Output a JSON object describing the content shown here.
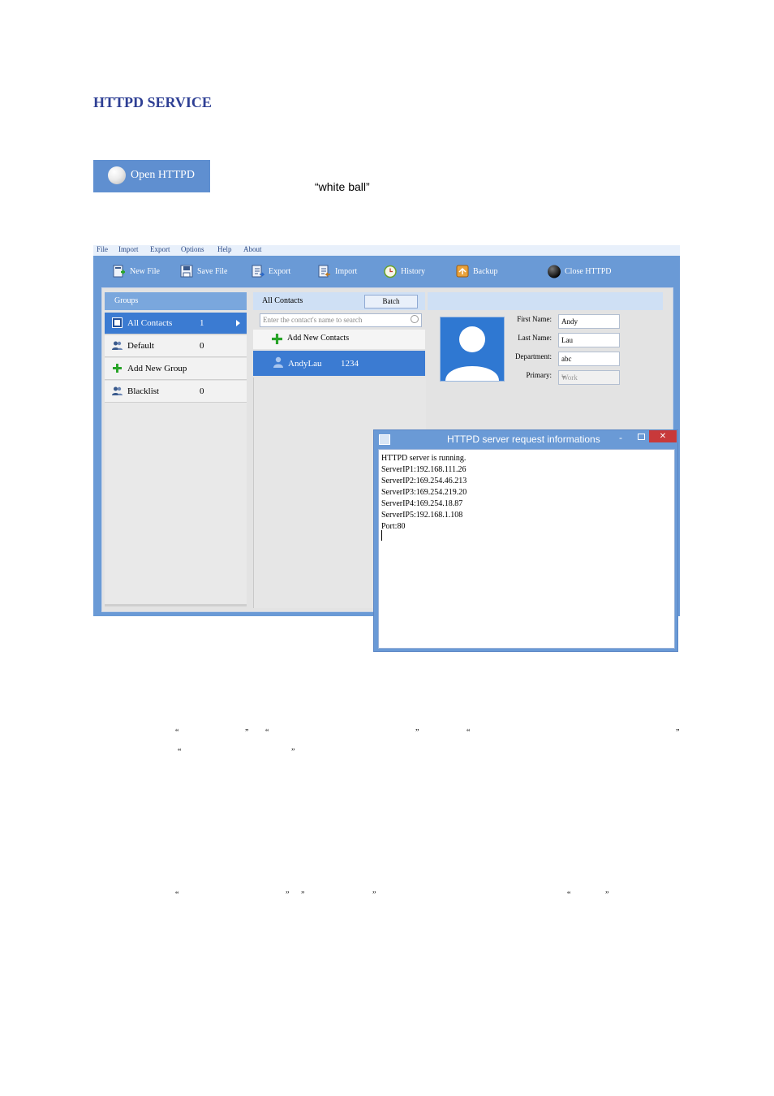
{
  "document": {
    "section_title": "HTTPD SERVICE",
    "open_button_label": "Open HTTPD",
    "white_ball_note": "“white ball”"
  },
  "app": {
    "menu": [
      "File",
      "Import",
      "Export",
      "Options",
      "Help",
      "About"
    ],
    "toolbar": {
      "new_file": "New File",
      "save_file": "Save File",
      "export": "Export",
      "import": "Import",
      "history": "History",
      "backup": "Backup",
      "close_httpd": "Close HTTPD"
    },
    "groups": {
      "header": "Groups",
      "items": [
        {
          "label": "All Contacts",
          "count": "1"
        },
        {
          "label": "Default",
          "count": "0"
        },
        {
          "label": "Add New Group",
          "count": ""
        },
        {
          "label": "Blacklist",
          "count": "0"
        }
      ]
    },
    "contacts": {
      "header": "All Contacts",
      "batch_label": "Batch",
      "search_placeholder": "Enter the contact's name to search",
      "add_label": "Add New Contacts",
      "rows": [
        {
          "name": "AndyLau",
          "number": "1234"
        }
      ]
    },
    "details": {
      "first_name_label": "First Name:",
      "first_name": "Andy",
      "last_name_label": "Last Name:",
      "last_name": "Lau",
      "department_label": "Department:",
      "department": "abc",
      "primary_label": "Primary:",
      "primary": "Work"
    },
    "dialog": {
      "title": "HTTPD server request informations",
      "min_glyph": "-",
      "close_glyph": "✕",
      "lines": [
        "HTTPD server is running.",
        "ServerIP1:192.168.111.26",
        "ServerIP2:169.254.46.213",
        "ServerIP3:169.254.219.20",
        "ServerIP4:169.254.18.87",
        "ServerIP5:192.168.1.108",
        "Port:80"
      ]
    }
  },
  "quote_marks": {
    "open": "“",
    "close": "”"
  },
  "colors": {
    "title": "#2e3f94",
    "window_blue": "#6a9ad6",
    "selection_blue": "#3b7bd2",
    "close_red": "#c8393a"
  }
}
